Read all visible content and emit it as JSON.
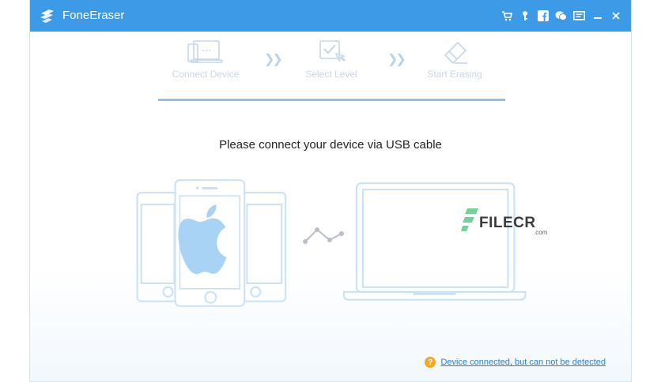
{
  "app": {
    "title": "FoneEraser",
    "accent_color": "#3d9ae6",
    "titlebar_icons": [
      "cart-icon",
      "key-icon",
      "facebook-icon",
      "chat-icon",
      "feedback-icon",
      "minimize-icon",
      "close-icon"
    ]
  },
  "steps": [
    {
      "label": "Connect Device",
      "icon": "devices-icon"
    },
    {
      "label": "Select Level",
      "icon": "select-level-icon"
    },
    {
      "label": "Start Erasing",
      "icon": "eraser-icon"
    }
  ],
  "main": {
    "heading": "Please connect your device via USB cable"
  },
  "watermark": {
    "text": "FILECR",
    "sub": ".com"
  },
  "footer": {
    "help_icon": "?",
    "help_link": "Device connected, but can not be detected"
  }
}
